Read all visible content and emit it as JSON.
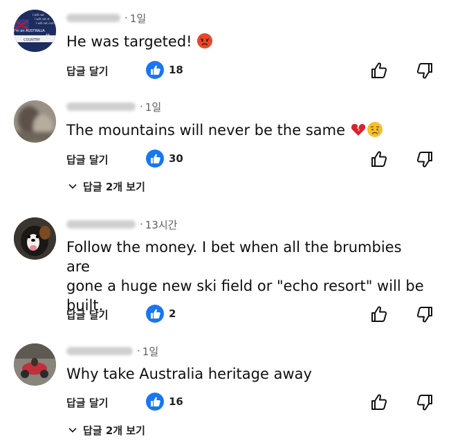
{
  "comments": [
    {
      "author": "",
      "time": "1일",
      "text": "He was targeted!",
      "emoji": "angry-face",
      "avatar_text": [
        "I will not",
        "I will not st",
        "I will not com",
        "I'm an AUSTRALIA",
        "AN",
        "COUNTRY"
      ],
      "reply_label": "답글 달기",
      "likes": "18",
      "replies_label": ""
    },
    {
      "author": "",
      "time": "1일",
      "text": "The mountains will never be the same",
      "emoji": "broken-heart-and-sad-face",
      "reply_label": "답글 달기",
      "likes": "30",
      "replies_label": "답글 2개 보기"
    },
    {
      "author": "",
      "time": "13시간",
      "text_lines": [
        "Follow the money.  I bet when all the brumbies are",
        "gone a huge new ski field or \"echo resort\" will be",
        "built."
      ],
      "reply_label": "답글 달기",
      "likes": "2",
      "replies_label": ""
    },
    {
      "author": "",
      "time": "1일",
      "text": "Why take  Australia  heritage  away",
      "reply_label": "답글 달기",
      "likes": "16",
      "replies_label": "답글 2개 보기"
    }
  ],
  "colors": {
    "like_badge": "#1877f2",
    "meta_text": "#606060",
    "body_text": "#0f0f0f"
  },
  "icons": [
    "thumb-up-outline-icon",
    "thumb-down-outline-icon",
    "like-badge-icon",
    "chevron-down-icon"
  ]
}
